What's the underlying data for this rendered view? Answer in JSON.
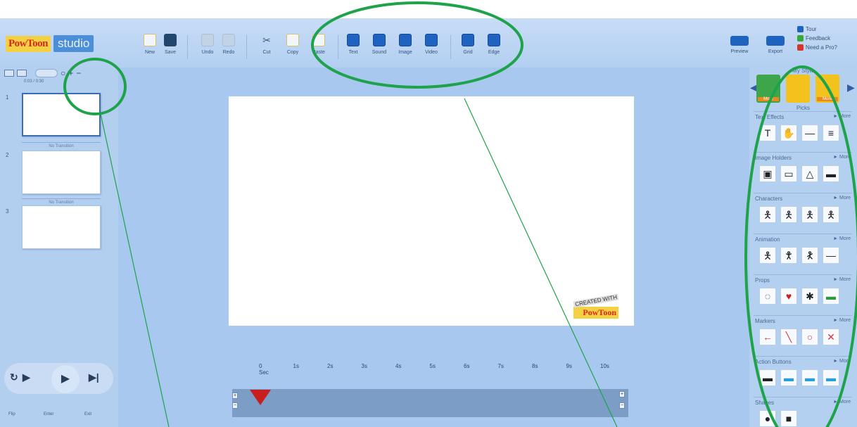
{
  "app": {
    "brand_name": "PowToon",
    "brand_product": "studio"
  },
  "toolbar": {
    "new": "New",
    "save": "Save",
    "undo": "Undo",
    "redo": "Redo",
    "cut": "Cut",
    "copy": "Copy",
    "paste": "Paste",
    "text": "Text",
    "sound": "Sound",
    "image": "Image",
    "video": "Video",
    "grid": "Grid",
    "edge": "Edge",
    "preview": "Preview",
    "export": "Export"
  },
  "help": {
    "tour": "Tour",
    "feedback": "Feedback",
    "need_pro": "Need a Pro?"
  },
  "slides_panel": {
    "time_caption": "0:03 / 0:30",
    "add": "+",
    "remove": "−",
    "slides": [
      {
        "number": "1"
      },
      {
        "number": "2"
      },
      {
        "number": "3"
      }
    ],
    "transition_label": "No Transition"
  },
  "playback": {
    "flip": "Flip",
    "enter": "Enter",
    "exit": "Exit"
  },
  "stage": {
    "watermark_small": "CREATED WITH",
    "watermark_brand": "PowToon"
  },
  "timeline": {
    "ticks": [
      "0 Sec",
      "1s",
      "2s",
      "3s",
      "4s",
      "5s",
      "6s",
      "7s",
      "8s",
      "9s",
      "10s"
    ],
    "plus": "+",
    "minus": "−"
  },
  "library": {
    "title": "My Style",
    "favorites_caption": "Picks",
    "more_tag": "More",
    "more_link": "► More",
    "categories": [
      {
        "name": "Text Effects"
      },
      {
        "name": "Image Holders"
      },
      {
        "name": "Characters"
      },
      {
        "name": "Animation"
      },
      {
        "name": "Props"
      },
      {
        "name": "Markers"
      },
      {
        "name": "Action Buttons"
      },
      {
        "name": "Shapes"
      }
    ]
  },
  "colors": {
    "app_bg": "#a9c8ef",
    "accent_blue": "#1f63c0",
    "annotation_green": "#1ea34a",
    "marker_red": "#c81e1e"
  }
}
